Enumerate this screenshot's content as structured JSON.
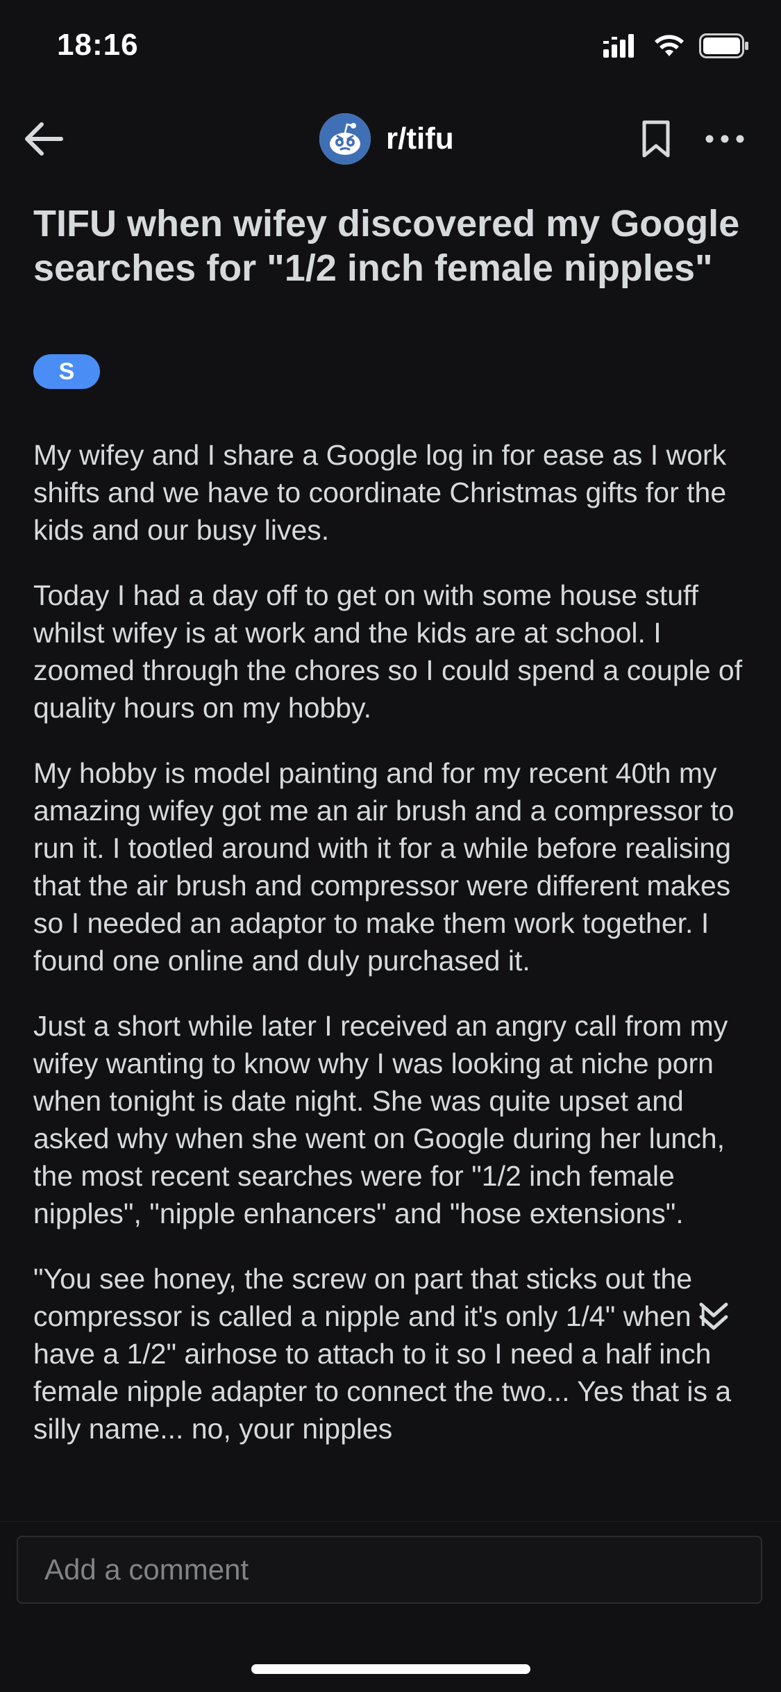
{
  "status_bar": {
    "time": "18:16",
    "icons": [
      "signal-icon",
      "wifi-icon",
      "battery-icon"
    ]
  },
  "nav": {
    "subreddit": "r/tifu",
    "icons": [
      "back-arrow-icon",
      "bookmark-icon",
      "more-icon"
    ]
  },
  "post": {
    "title": "TIFU when wifey discovered my Google searches for \"1/2 inch female nipples\"",
    "flair": "S",
    "paragraphs": [
      "My wifey and I share a Google log in for ease as I work shifts and we have to coordinate Christmas gifts for the kids and our busy lives.",
      "Today I had a day off to get on with some house stuff whilst wifey is at work and the kids are at school. I zoomed through the chores so I could spend a couple of quality hours on my hobby.",
      "My hobby is model painting and for my recent 40th my amazing wifey got me an air brush and a compressor to run it. I tootled around with it for a while before realising that the air brush and compressor were different makes so I needed an adaptor to make them work together. I found one online and duly purchased it.",
      "Just a short while later I received an angry call from my wifey wanting to know why I was looking at niche porn  when tonight is date night. She was quite upset and asked why when she went on Google during her lunch, the most recent searches were for \"1/2 inch female nipples\", \"nipple enhancers\" and \"hose extensions\".",
      "\"You see honey, the screw on part that sticks out the compressor is called a nipple and it's only 1/4\" when I have a 1/2\" airhose to attach to it so I need a half inch female nipple adapter to connect the two... Yes that is a silly name... no, your nipples"
    ]
  },
  "comment": {
    "placeholder": "Add a comment"
  },
  "colors": {
    "background": "#111114",
    "text": "#d7dadc",
    "flair": "#4a8ef5"
  }
}
